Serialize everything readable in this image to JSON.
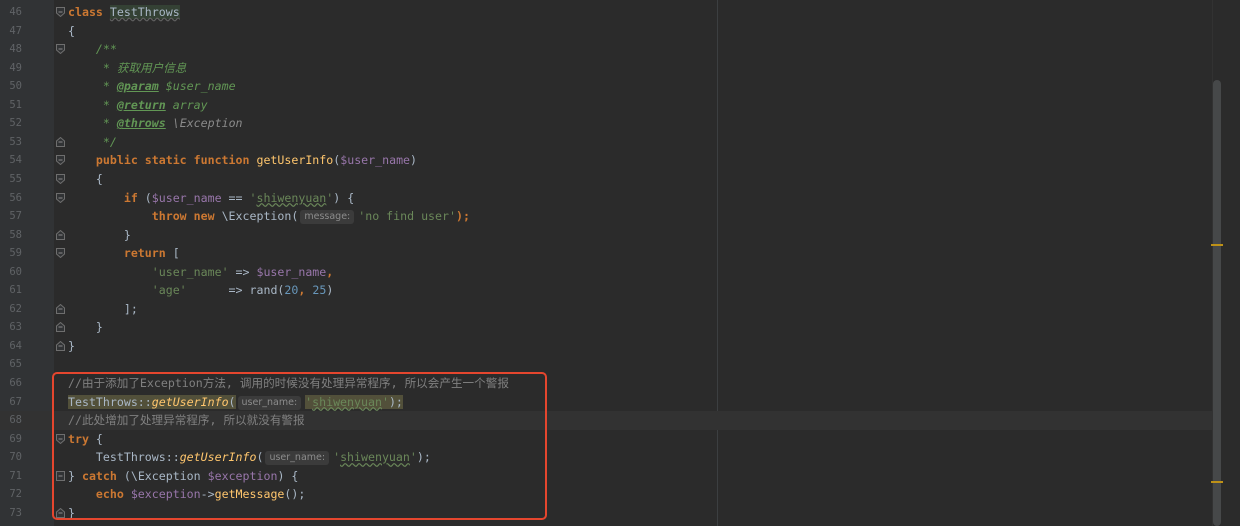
{
  "editor": {
    "lines": [
      {
        "n": "46",
        "tokens": [
          {
            "t": "class ",
            "c": "kw"
          },
          {
            "t": "TestThrows",
            "c": "cls-hl"
          }
        ]
      },
      {
        "n": "47",
        "tokens": [
          {
            "t": "{",
            "c": ""
          }
        ]
      },
      {
        "n": "48",
        "tokens": [
          {
            "t": "    /**",
            "c": "doc"
          }
        ]
      },
      {
        "n": "49",
        "tokens": [
          {
            "t": "     * 获取用户信息",
            "c": "doc"
          }
        ]
      },
      {
        "n": "50",
        "tokens": [
          {
            "t": "     * ",
            "c": "doc"
          },
          {
            "t": "@param",
            "c": "doctag"
          },
          {
            "t": " $user_name",
            "c": "doc"
          }
        ]
      },
      {
        "n": "51",
        "tokens": [
          {
            "t": "     * ",
            "c": "doc"
          },
          {
            "t": "@return",
            "c": "doctag"
          },
          {
            "t": " array",
            "c": "doc"
          }
        ]
      },
      {
        "n": "52",
        "tokens": [
          {
            "t": "     * ",
            "c": "doc"
          },
          {
            "t": "@throws",
            "c": "doctag"
          },
          {
            "t": " \\Exception",
            "c": "doctype"
          }
        ]
      },
      {
        "n": "53",
        "tokens": [
          {
            "t": "     */",
            "c": "doc"
          }
        ]
      },
      {
        "n": "54",
        "tokens": [
          {
            "t": "    public static function ",
            "c": "kw"
          },
          {
            "t": "getUserInfo",
            "c": "fn"
          },
          {
            "t": "(",
            "c": ""
          },
          {
            "t": "$user_name",
            "c": "var"
          },
          {
            "t": ")",
            "c": ""
          }
        ]
      },
      {
        "n": "55",
        "tokens": [
          {
            "t": "    {",
            "c": ""
          }
        ]
      },
      {
        "n": "56",
        "tokens": [
          {
            "t": "        if ",
            "c": "kw"
          },
          {
            "t": "(",
            "c": ""
          },
          {
            "t": "$user_name",
            "c": "var"
          },
          {
            "t": " == ",
            "c": ""
          },
          {
            "t": "'",
            "c": "str"
          },
          {
            "t": "shiwenyuan",
            "c": "str typo"
          },
          {
            "t": "'",
            "c": "str"
          },
          {
            "t": ") {",
            "c": ""
          }
        ]
      },
      {
        "n": "57",
        "tokens": [
          {
            "t": "            throw new ",
            "c": "kw"
          },
          {
            "t": "\\Exception(",
            "c": ""
          },
          {
            "t": "message:",
            "c": "hint"
          },
          {
            "t": "'no find user'",
            "c": "str"
          },
          {
            "t": ");",
            "c": "kw"
          }
        ]
      },
      {
        "n": "58",
        "tokens": [
          {
            "t": "        }",
            "c": ""
          }
        ]
      },
      {
        "n": "59",
        "tokens": [
          {
            "t": "        return ",
            "c": "kw"
          },
          {
            "t": "[",
            "c": ""
          }
        ]
      },
      {
        "n": "60",
        "tokens": [
          {
            "t": "            ",
            "c": ""
          },
          {
            "t": "'user_name'",
            "c": "str"
          },
          {
            "t": " => ",
            "c": ""
          },
          {
            "t": "$user_name",
            "c": "var"
          },
          {
            "t": ",",
            "c": "kw"
          }
        ]
      },
      {
        "n": "61",
        "tokens": [
          {
            "t": "            ",
            "c": ""
          },
          {
            "t": "'age'",
            "c": "str"
          },
          {
            "t": "      => ",
            "c": ""
          },
          {
            "t": "rand(",
            "c": ""
          },
          {
            "t": "20",
            "c": "num"
          },
          {
            "t": ", ",
            "c": "kw"
          },
          {
            "t": "25",
            "c": "num"
          },
          {
            "t": ")",
            "c": ""
          }
        ]
      },
      {
        "n": "62",
        "tokens": [
          {
            "t": "        ];",
            "c": ""
          }
        ]
      },
      {
        "n": "63",
        "tokens": [
          {
            "t": "    }",
            "c": ""
          }
        ]
      },
      {
        "n": "64",
        "tokens": [
          {
            "t": "}",
            "c": ""
          }
        ]
      },
      {
        "n": "65",
        "tokens": [
          {
            "t": "",
            "c": ""
          }
        ]
      },
      {
        "n": "66",
        "tokens": [
          {
            "t": "//由于添加了Exception方法, 调用的时候没有处理异常程序, 所以会产生一个警报",
            "c": "cmt"
          }
        ]
      },
      {
        "n": "67",
        "tokens": [
          {
            "t": "TestThrows::",
            "c": "warn-hl"
          },
          {
            "t": "getUserInfo",
            "c": "fn-i warn-hl"
          },
          {
            "t": "(",
            "c": "warn-hl"
          },
          {
            "t": "user_name:",
            "c": "hint"
          },
          {
            "t": "'",
            "c": "str warn-hl"
          },
          {
            "t": "shiwenyuan",
            "c": "str typo warn-hl"
          },
          {
            "t": "'",
            "c": "str warn-hl"
          },
          {
            "t": ");",
            "c": "warn-hl"
          }
        ]
      },
      {
        "n": "68",
        "tokens": [
          {
            "t": "//此处增加了处理异常程序, 所以就没有警报",
            "c": "cmt"
          }
        ]
      },
      {
        "n": "69",
        "tokens": [
          {
            "t": "try ",
            "c": "kw"
          },
          {
            "t": "{",
            "c": ""
          }
        ]
      },
      {
        "n": "70",
        "tokens": [
          {
            "t": "    TestThrows::",
            "c": ""
          },
          {
            "t": "getUserInfo",
            "c": "fn-i"
          },
          {
            "t": "(",
            "c": ""
          },
          {
            "t": "user_name:",
            "c": "hint"
          },
          {
            "t": "'",
            "c": "str"
          },
          {
            "t": "shiwenyuan",
            "c": "str typo"
          },
          {
            "t": "'",
            "c": "str"
          },
          {
            "t": ");",
            "c": ""
          }
        ]
      },
      {
        "n": "71",
        "tokens": [
          {
            "t": "} ",
            "c": ""
          },
          {
            "t": "catch ",
            "c": "kw"
          },
          {
            "t": "(\\Exception ",
            "c": ""
          },
          {
            "t": "$exception",
            "c": "var"
          },
          {
            "t": ") {",
            "c": ""
          }
        ]
      },
      {
        "n": "72",
        "tokens": [
          {
            "t": "    echo ",
            "c": "kw"
          },
          {
            "t": "$exception",
            "c": "var"
          },
          {
            "t": "->",
            "c": ""
          },
          {
            "t": "getMessage",
            "c": "fn"
          },
          {
            "t": "();",
            "c": ""
          }
        ]
      },
      {
        "n": "73",
        "tokens": [
          {
            "t": "}",
            "c": ""
          }
        ]
      }
    ],
    "current_line": "68",
    "colors": {
      "background": "#2b2b2b",
      "gutter": "#313335",
      "annotation_box": "#e5462e",
      "scroll_marker": "#be9117"
    }
  }
}
